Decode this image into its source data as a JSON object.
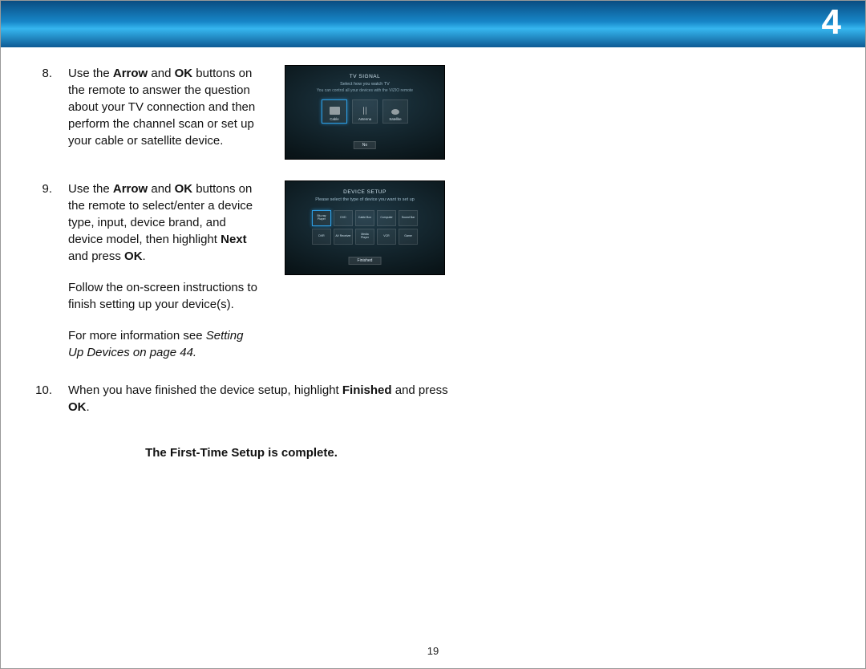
{
  "chapter_number": "4",
  "page_number": "19",
  "steps": {
    "s8": {
      "num": "8.",
      "text_html": "Use the <strong>Arrow</strong> and <strong>OK</strong> buttons on the remote to answer the question about your TV connection and then perform the channel scan or set up your cable or satellite device."
    },
    "s9": {
      "num": "9.",
      "p1_html": "Use the <strong>Arrow</strong> and <strong>OK</strong> buttons on the remote to select/enter a device type, input, device brand, and device model, then highlight <strong>Next</strong> and press <strong>OK</strong>.",
      "p2": "Follow the on-screen instructions to finish setting up your device(s).",
      "p3_lead": "For more information see ",
      "p3_ref": "Setting Up Devices on page 44.",
      "p3_tail": ""
    },
    "s10": {
      "num": "10.",
      "text_html": "When you have finished the device setup, highlight <strong>Finished</strong> and press <strong>OK</strong>."
    }
  },
  "completion": "The First-Time Setup is complete.",
  "tv_signal": {
    "title": "TV SIGNAL",
    "sub": "Select how you watch TV",
    "caption": "You can control all your devices with the VIZIO remote",
    "options": [
      "Cable",
      "Antenna",
      "Satellite"
    ],
    "selected_index": 0,
    "button": "No"
  },
  "device_setup": {
    "title": "DEVICE SETUP",
    "sub": "Please select the type of device you want to set up",
    "options": [
      "Blu-ray Player",
      "DVD",
      "Cable Box",
      "Computer",
      "Sound Bar",
      "DVR",
      "AV Receiver",
      "Media Player",
      "VCR",
      "Game"
    ],
    "selected_index": 0,
    "button": "Finished"
  }
}
